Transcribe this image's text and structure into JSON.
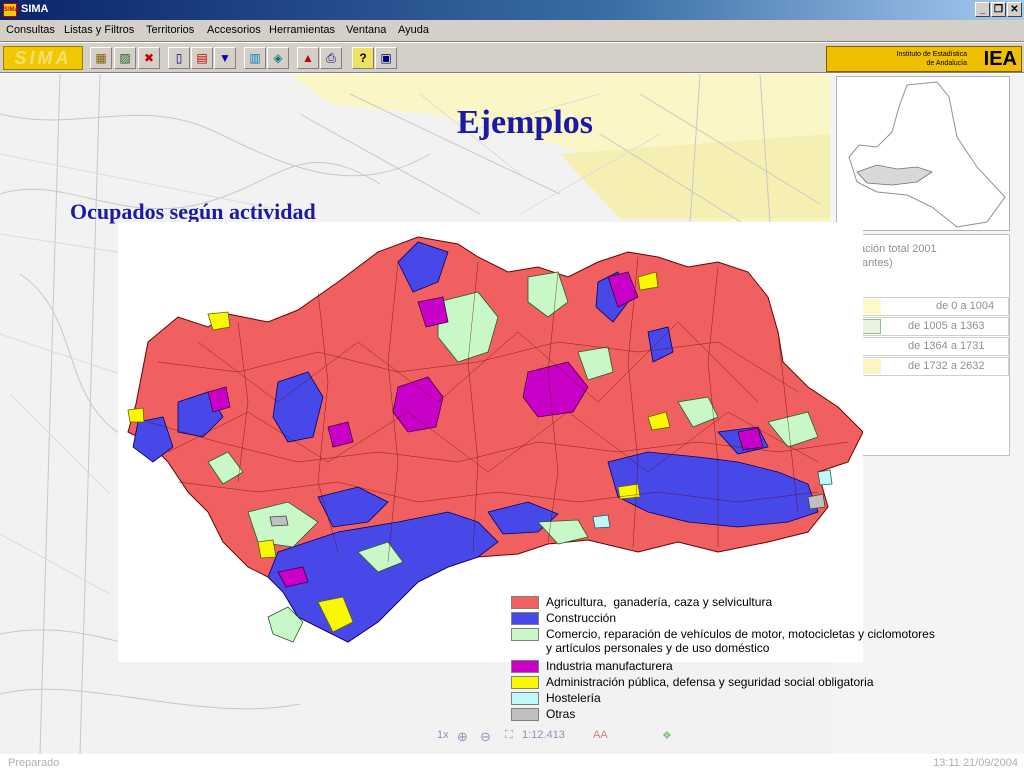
{
  "window": {
    "title": "SIMA",
    "app_icon": "sima-app-icon",
    "minimize_label": "_",
    "restore_label": "❐",
    "close_label": "✕"
  },
  "menu": [
    {
      "label": "Consultas"
    },
    {
      "label": "Listas y Filtros"
    },
    {
      "label": "Territorios"
    },
    {
      "label": "Accesorios"
    },
    {
      "label": "Herramientas"
    },
    {
      "label": "Ventana"
    },
    {
      "label": "Ayuda"
    }
  ],
  "toolbar": {
    "logo_text": "SIMA",
    "buttons": [
      {
        "icon": "table-icon",
        "glyph": "▦"
      },
      {
        "icon": "chart-edit-icon",
        "glyph": "▨"
      },
      {
        "icon": "delete-icon",
        "glyph": "✖"
      },
      {
        "icon": "document-icon",
        "glyph": "▯"
      },
      {
        "icon": "report-icon",
        "glyph": "▤"
      },
      {
        "icon": "filter-icon",
        "glyph": "▼"
      },
      {
        "icon": "bar-chart-icon",
        "glyph": "▥"
      },
      {
        "icon": "map-icon",
        "glyph": "◈"
      },
      {
        "icon": "pyramid-icon",
        "glyph": "▲"
      },
      {
        "icon": "print-icon",
        "glyph": "⎙"
      },
      {
        "icon": "help-icon",
        "glyph": "?"
      },
      {
        "icon": "demo-icon",
        "glyph": "▣"
      }
    ],
    "institution_line1": "Instituto de Estadística",
    "institution_line2": "de Andalucía",
    "institution_abbr": "IEA"
  },
  "slide": {
    "title": "Ejemplos",
    "subtitle": "Ocupados según actividad"
  },
  "right_panel": {
    "title": "ación total 2001",
    "subtitle": "tantes)",
    "ranges": [
      {
        "label": "de 0 a 1004",
        "color": "#fdf9c8"
      },
      {
        "label": "de 1005 a 1363",
        "color": "#e8f4e0"
      },
      {
        "label": "de 1364 a 1731",
        "color": "#ffffff"
      },
      {
        "label": "de 1732 a 2632",
        "color": "#fdf5c0"
      }
    ]
  },
  "map_legend": [
    {
      "label": "Agricultura,  ganadería, caza y selvicultura",
      "color": "#f06060"
    },
    {
      "label": "Construcción",
      "color": "#4848e8"
    },
    {
      "label": "Comercio, reparación de vehículos de motor, motocicletas y ciclomotores\ny artículos personales y de uso doméstico",
      "color": "#c8f8c8"
    },
    {
      "label": "Industria manufacturera",
      "color": "#c800c8"
    },
    {
      "label": "Administración pública, defensa y seguridad social obligatoria",
      "color": "#f8f800"
    },
    {
      "label": "Hostelería",
      "color": "#c0f8f8"
    },
    {
      "label": "Otras",
      "color": "#c0c0c0"
    }
  ],
  "zoom": {
    "zoom_label": "1x",
    "scale": "1:12.413"
  },
  "status": {
    "left": "Preparado",
    "right": "13:11   21/09/2004"
  }
}
